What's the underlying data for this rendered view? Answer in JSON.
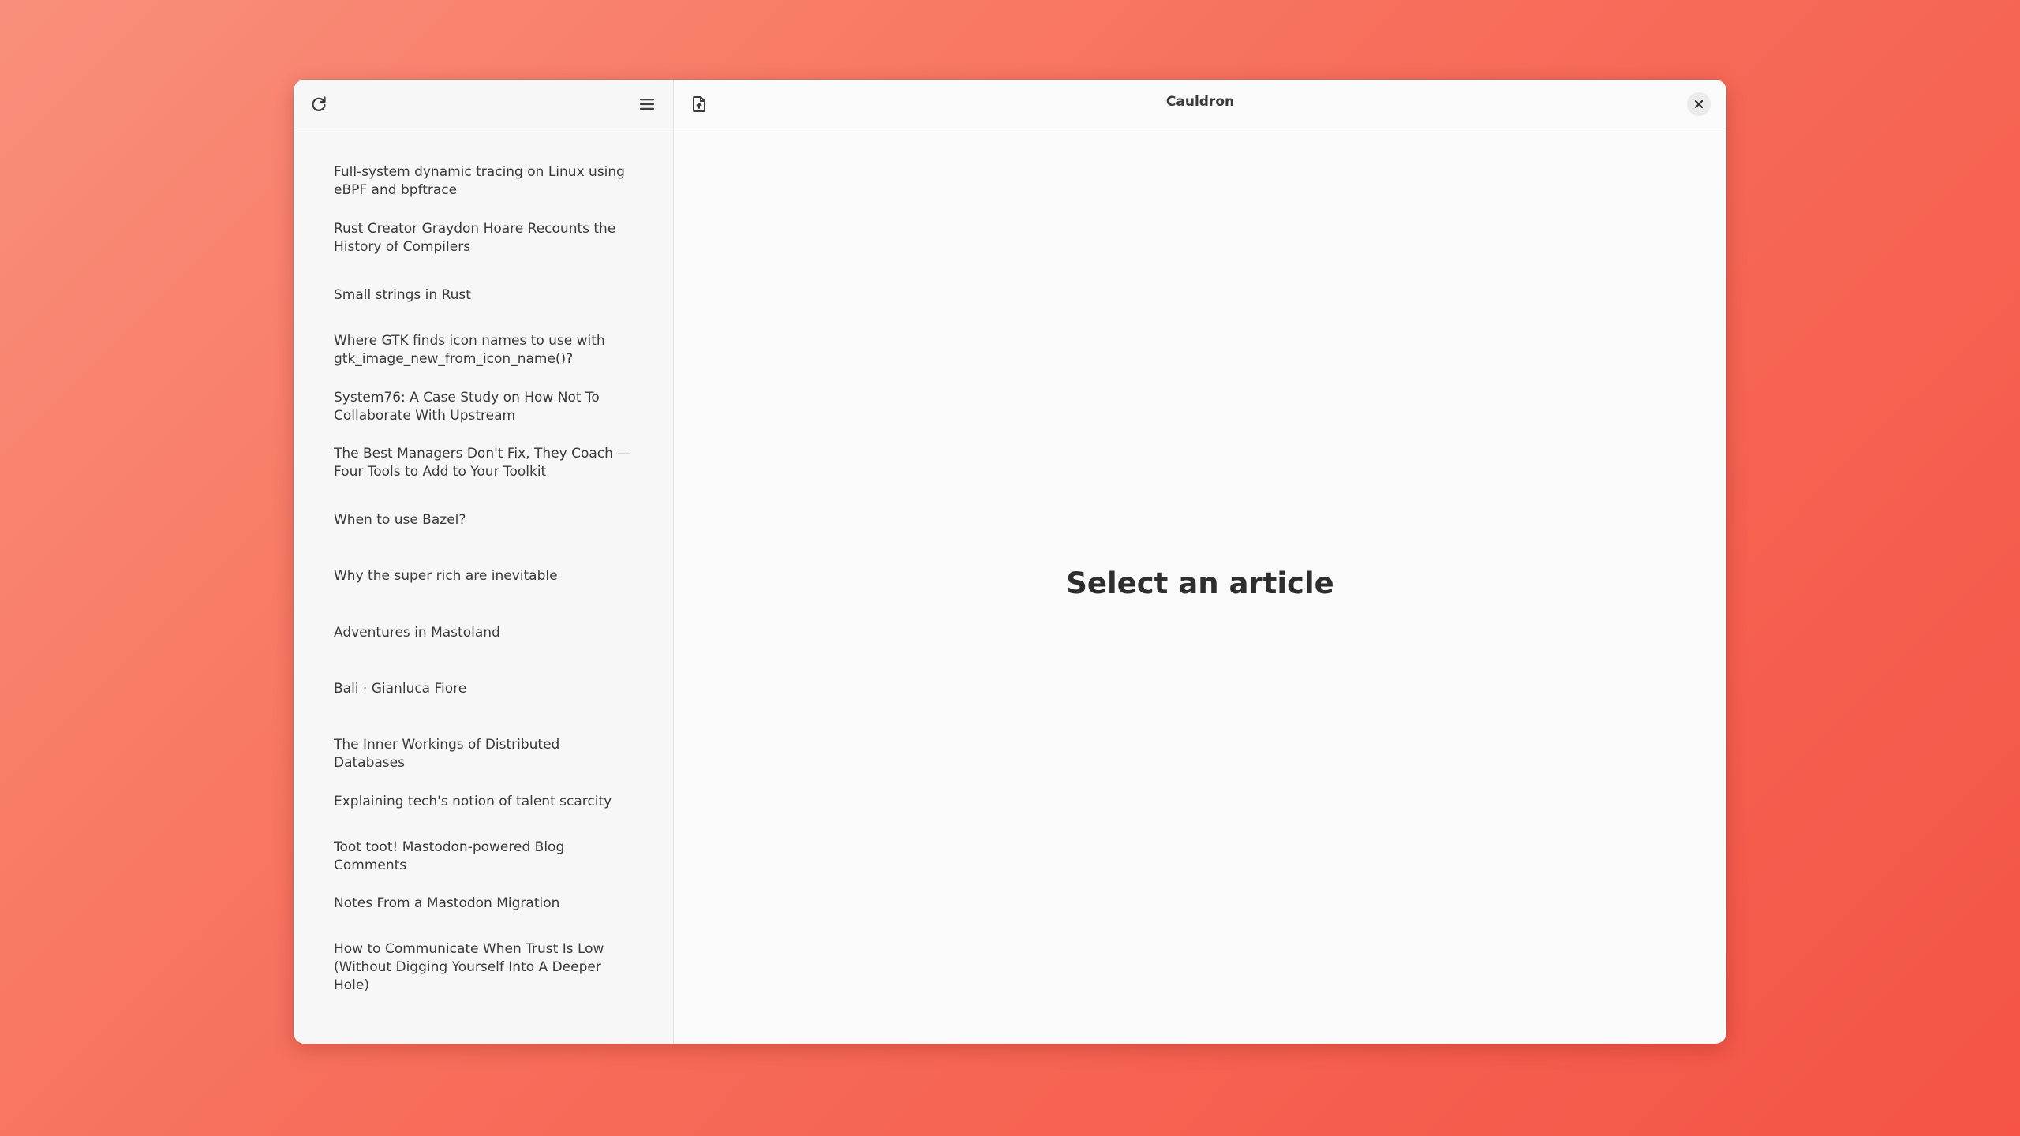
{
  "window": {
    "title": "Cauldron"
  },
  "sidebar": {
    "articles": [
      "Full-system dynamic tracing on Linux using eBPF and bpftrace",
      "Rust Creator Graydon Hoare Recounts the History of Compilers",
      "Small strings in Rust",
      "Where GTK finds icon names to use with gtk_image_new_from_icon_name()?",
      "System76: A Case Study on How Not To Collaborate With Upstream",
      "The Best Managers Don't Fix, They Coach — Four Tools to Add to Your Toolkit",
      "When to use Bazel?",
      "Why the super rich are inevitable",
      "Adventures in Mastoland",
      "Bali · Gianluca Fiore",
      "The Inner Workings of Distributed Databases",
      "Explaining tech's notion of talent scarcity",
      "Toot toot! Mastodon-powered Blog Comments",
      "Notes From a Mastodon Migration",
      "How to Communicate When Trust Is Low (Without Digging Yourself Into A Deeper Hole)"
    ]
  },
  "content": {
    "placeholder": "Select an article"
  },
  "icons": {
    "refresh": "refresh-icon",
    "menu": "hamburger-menu-icon",
    "document": "document-open-icon",
    "close": "close-icon"
  },
  "colors": {
    "background_start": "#f98f7a",
    "background_end": "#f45345",
    "window_bg": "#fafafa",
    "sidebar_bg": "#f7f7f7",
    "text": "#3a3a3a"
  }
}
